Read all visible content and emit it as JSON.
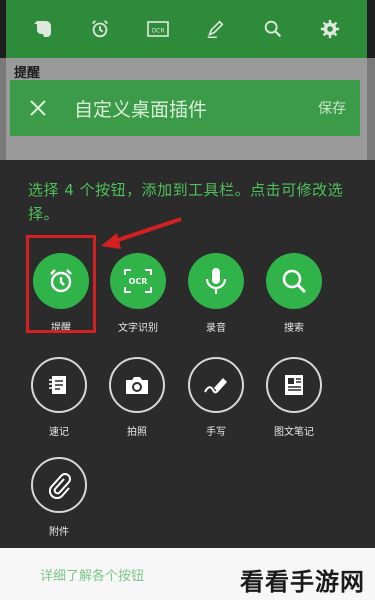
{
  "background_app": {
    "section_label": "提醒",
    "toolbar_icons": [
      "elephant-icon",
      "alarm-clock-icon",
      "ocr-icon",
      "pen-icon",
      "search-icon",
      "gear-icon"
    ]
  },
  "widget_bar": {
    "title": "自定义桌面插件",
    "save_label": "保存"
  },
  "sheet": {
    "description": "选择 4 个按钮，添加到工具栏。点击可修改选择。",
    "selected_buttons": [
      {
        "label": "提醒",
        "icon": "alarm-clock-icon"
      },
      {
        "label": "文字识别",
        "icon": "ocr-icon"
      },
      {
        "label": "录音",
        "icon": "microphone-icon"
      },
      {
        "label": "搜索",
        "icon": "search-icon"
      }
    ],
    "other_buttons": [
      {
        "label": "速记",
        "icon": "quick-note-icon"
      },
      {
        "label": "拍照",
        "icon": "camera-icon"
      },
      {
        "label": "手写",
        "icon": "handwriting-icon"
      },
      {
        "label": "图文笔记",
        "icon": "image-text-note-icon"
      },
      {
        "label": "附件",
        "icon": "paperclip-icon"
      }
    ]
  },
  "footer": {
    "link": "详细了解各个按钮"
  },
  "watermark": "看看手游网",
  "colors": {
    "accent_green": "#30b44a",
    "highlight_red": "#d42020"
  }
}
